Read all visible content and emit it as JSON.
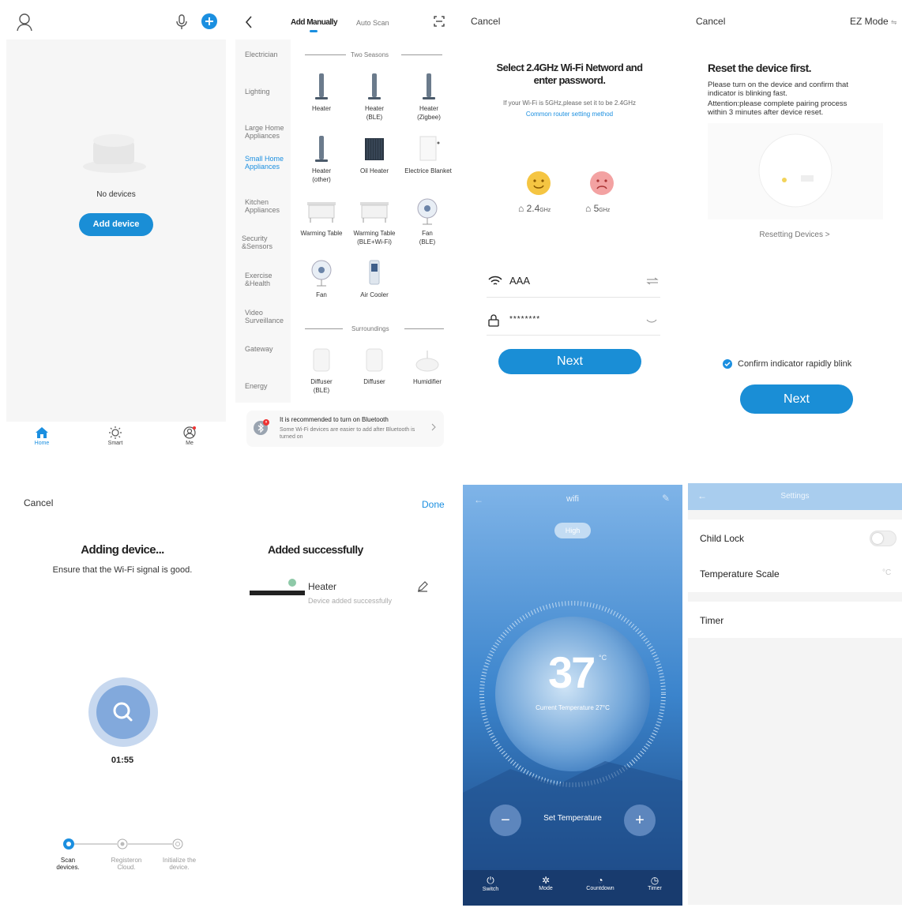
{
  "panel1": {
    "empty_text": "No devices",
    "add_button": "Add device",
    "tabs": [
      {
        "label": "Home",
        "icon": "home-icon"
      },
      {
        "label": "Smart",
        "icon": "sun-icon"
      },
      {
        "label": "Me",
        "icon": "user-circle-icon"
      }
    ]
  },
  "panel2": {
    "tab_manual": "Add Manually",
    "tab_auto": "Auto Scan",
    "categories": [
      "Electrician",
      "Lighting",
      "Large Home\nAppliances",
      "Small Home\nAppliances",
      "Kitchen\nAppliances",
      "Security\n&Sensors",
      "Exercise\n&Health",
      "Video\nSurveillance",
      "Gateway",
      "Energy"
    ],
    "section_two_seasons": "Two Seasons",
    "section_surroundings": "Surroundings",
    "devices": [
      {
        "name": "Heater",
        "sub": ""
      },
      {
        "name": "Heater",
        "sub": "(BLE)"
      },
      {
        "name": "Heater",
        "sub": "(Zigbee)"
      },
      {
        "name": "Heater",
        "sub": "(other)"
      },
      {
        "name": "Oil Heater",
        "sub": ""
      },
      {
        "name": "Electrice Blanket",
        "sub": ""
      },
      {
        "name": "Warming Table",
        "sub": ""
      },
      {
        "name": "Warming Table",
        "sub": "(BLE+Wi-Fi)"
      },
      {
        "name": "Fan",
        "sub": "(BLE)"
      },
      {
        "name": "Fan",
        "sub": ""
      },
      {
        "name": "Air Cooler",
        "sub": ""
      }
    ],
    "surroundings": [
      {
        "name": "Diffuser",
        "sub": "(BLE)"
      },
      {
        "name": "Diffuser",
        "sub": ""
      },
      {
        "name": "Humidifier",
        "sub": ""
      }
    ],
    "bt_title": "It is recommended to turn on Bluetooth",
    "bt_desc": "Some Wi-Fi devices are easier to add after Bluetooth is turned on"
  },
  "panel3": {
    "cancel": "Cancel",
    "title": "Select 2.4GHz Wi-Fi Netword and enter password.",
    "note": "If your Wi-Fi is 5GHz,please set it to be 2.4GHz",
    "note_link": "Common router setting method",
    "band_24": "2.4",
    "band_5": "5",
    "band_unit": "GHz",
    "ssid": "AAA",
    "password": "********",
    "next": "Next"
  },
  "panel4": {
    "cancel": "Cancel",
    "mode": "EZ Mode",
    "title": "Reset the device first.",
    "desc1": "Please turn on the device and confirm that indicator is blinking fast.",
    "desc2": "Attention:please complete pairing process within 3 minutes after device reset.",
    "resetting": "Resetting Devices",
    "confirm": "Confirm indicator rapidly blink",
    "next": "Next"
  },
  "panel5": {
    "cancel": "Cancel",
    "title": "Adding device...",
    "subtitle": "Ensure that the Wi-Fi signal is good.",
    "timer": "01:55",
    "steps": [
      "Scan devices.",
      "Registeron Cloud.",
      "Initialize the device."
    ]
  },
  "panel6": {
    "done": "Done",
    "title": "Added successfully",
    "device_name": "Heater",
    "device_status": "Device added successfully"
  },
  "panel7": {
    "title": "wifi",
    "mode_chip": "High",
    "temp": "37",
    "temp_unit": "°C",
    "current": "Current Temperature 27°C",
    "set_temp": "Set Temperature",
    "controls": [
      "Switch",
      "Mode",
      "Countdown",
      "Timer"
    ]
  },
  "panel8": {
    "title": "Settings",
    "rows": [
      "Child Lock",
      "Temperature Scale",
      "Timer"
    ],
    "temp_scale_value": "°C"
  }
}
